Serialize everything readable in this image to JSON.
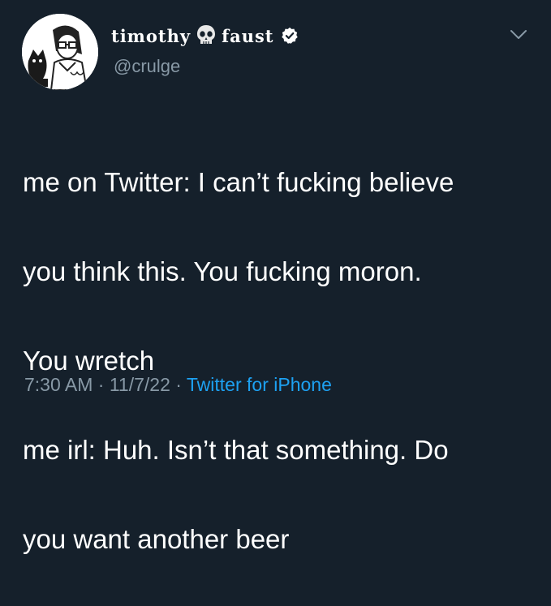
{
  "tweet": {
    "author": {
      "name_first": "timothy",
      "name_emoji": "skull-icon",
      "name_last": "faust",
      "handle": "@crulge",
      "verified": true
    },
    "body_lines": [
      "me on Twitter: I can’t fucking believe",
      "you think this. You fucking moron.",
      "You wretch",
      "me irl: Huh. Isn’t that something. Do",
      "you want another beer"
    ],
    "time": "7:30 AM",
    "date": "11/7/22",
    "separator": " · ",
    "source": "Twitter for iPhone"
  },
  "colors": {
    "background": "#15202b",
    "text_primary": "#ffffff",
    "text_secondary": "#8899a6",
    "link": "#1da1f2"
  }
}
